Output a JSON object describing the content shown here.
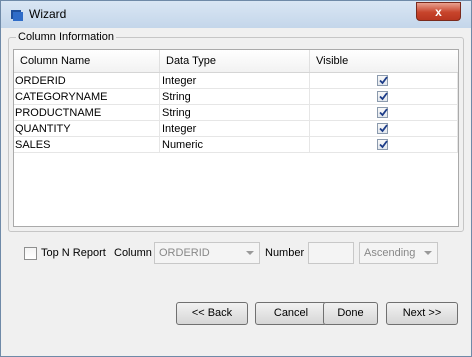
{
  "window": {
    "title": "Wizard",
    "close_label": "x"
  },
  "column_info": {
    "label": "Column Information",
    "headers": [
      "Column Name",
      "Data Type",
      "Visible"
    ],
    "rows": [
      {
        "name": "ORDERID",
        "type": "Integer",
        "visible": true
      },
      {
        "name": "CATEGORYNAME",
        "type": "String",
        "visible": true
      },
      {
        "name": "PRODUCTNAME",
        "type": "String",
        "visible": true
      },
      {
        "name": "QUANTITY",
        "type": "Integer",
        "visible": true
      },
      {
        "name": "SALES",
        "type": "Numeric",
        "visible": true
      }
    ]
  },
  "options": {
    "topn_label": "Top N Report",
    "topn_checked": false,
    "column_label": "Column",
    "column_value": "ORDERID",
    "number_label": "Number",
    "number_value": "",
    "order_value": "Ascending"
  },
  "buttons": {
    "back": "<< Back",
    "cancel": "Cancel",
    "done": "Done",
    "next": "Next >>"
  },
  "colors": {
    "titlebar": "#c4d6ea",
    "close_button": "#c7442b",
    "check": "#1c3c88"
  }
}
